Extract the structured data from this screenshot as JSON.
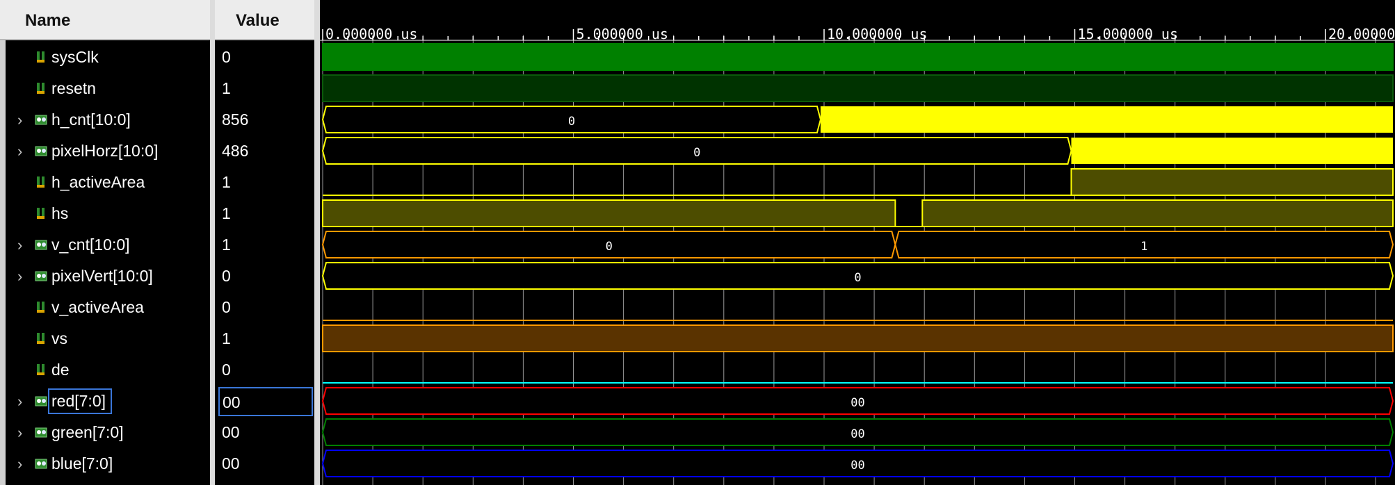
{
  "headers": {
    "name": "Name",
    "value": "Value"
  },
  "timeline": {
    "labels": [
      "0.000000 us",
      "5.000000 us",
      "10.000000 us",
      "15.000000 us",
      "20.00000"
    ],
    "label_times_us": [
      0,
      5,
      10,
      15,
      20
    ]
  },
  "signals": [
    {
      "name": "sysClk",
      "value": "0",
      "expandable": false,
      "icon": "bit-signal-icon"
    },
    {
      "name": "resetn",
      "value": "1",
      "expandable": false,
      "icon": "bit-signal-icon"
    },
    {
      "name": "h_cnt[10:0]",
      "value": "856",
      "expandable": true,
      "icon": "bus-signal-icon"
    },
    {
      "name": "pixelHorz[10:0]",
      "value": "486",
      "expandable": true,
      "icon": "bus-signal-icon"
    },
    {
      "name": "h_activeArea",
      "value": "1",
      "expandable": false,
      "icon": "bit-signal-icon"
    },
    {
      "name": "hs",
      "value": "1",
      "expandable": false,
      "icon": "bit-signal-icon"
    },
    {
      "name": "v_cnt[10:0]",
      "value": "1",
      "expandable": true,
      "icon": "bus-signal-icon"
    },
    {
      "name": "pixelVert[10:0]",
      "value": "0",
      "expandable": true,
      "icon": "bus-signal-icon"
    },
    {
      "name": "v_activeArea",
      "value": "0",
      "expandable": false,
      "icon": "bit-signal-icon"
    },
    {
      "name": "vs",
      "value": "1",
      "expandable": false,
      "icon": "bit-signal-icon"
    },
    {
      "name": "de",
      "value": "0",
      "expandable": false,
      "icon": "bit-signal-icon"
    },
    {
      "name": "red[7:0]",
      "value": "00",
      "expandable": true,
      "icon": "bus-signal-icon",
      "selected": true
    },
    {
      "name": "green[7:0]",
      "value": "00",
      "expandable": true,
      "icon": "bus-signal-icon"
    },
    {
      "name": "blue[7:0]",
      "value": "00",
      "expandable": true,
      "icon": "bus-signal-icon"
    }
  ],
  "waves": [
    {
      "signal": "sysClk",
      "kind": "fill",
      "color": "#008000"
    },
    {
      "signal": "resetn",
      "kind": "fill",
      "color": "#003300",
      "edge": "#0b5a0b"
    },
    {
      "signal": "h_cnt[10:0]",
      "kind": "bus",
      "color": "#ffff00",
      "segments": [
        {
          "t0": 0,
          "t1": 9.93,
          "label": "0"
        },
        {
          "t0": 9.93,
          "t1": 21.5,
          "solid": true
        }
      ]
    },
    {
      "signal": "pixelHorz[10:0]",
      "kind": "bus",
      "color": "#ffff00",
      "segments": [
        {
          "t0": 0,
          "t1": 14.93,
          "label": "0"
        },
        {
          "t0": 14.93,
          "t1": 21.5,
          "solid": true
        }
      ]
    },
    {
      "signal": "h_activeArea",
      "kind": "bit",
      "color": "#ffff00",
      "fill": "#4d4d00",
      "highs": [
        [
          14.93,
          21.5
        ]
      ]
    },
    {
      "signal": "hs",
      "kind": "bit",
      "color": "#ffff00",
      "fill": "#4d4d00",
      "highs": [
        [
          0,
          11.42
        ],
        [
          11.96,
          21.5
        ]
      ]
    },
    {
      "signal": "v_cnt[10:0]",
      "kind": "bus",
      "color": "#ff9900",
      "segments": [
        {
          "t0": 0,
          "t1": 11.42,
          "label": "0"
        },
        {
          "t0": 11.42,
          "t1": 21.5,
          "label": "1"
        }
      ]
    },
    {
      "signal": "pixelVert[10:0]",
      "kind": "bus",
      "color": "#ffff00",
      "segments": [
        {
          "t0": 0,
          "t1": 21.5,
          "label": "0"
        }
      ]
    },
    {
      "signal": "v_activeArea",
      "kind": "bit",
      "color": "#ff9900",
      "fill": "#5a3300",
      "highs": []
    },
    {
      "signal": "vs",
      "kind": "bit",
      "color": "#ff9900",
      "fill": "#5a3300",
      "highs": [
        [
          0,
          21.5
        ]
      ]
    },
    {
      "signal": "de",
      "kind": "bit",
      "color": "#00ffff",
      "fill": "#003333",
      "highs": []
    },
    {
      "signal": "red[7:0]",
      "kind": "bus",
      "color": "#ff0000",
      "segments": [
        {
          "t0": 0,
          "t1": 21.5,
          "label": "00"
        }
      ]
    },
    {
      "signal": "green[7:0]",
      "kind": "bus",
      "color": "#008000",
      "segments": [
        {
          "t0": 0,
          "t1": 21.5,
          "label": "00"
        }
      ]
    },
    {
      "signal": "blue[7:0]",
      "kind": "bus",
      "color": "#0000ff",
      "segments": [
        {
          "t0": 0,
          "t1": 21.5,
          "label": "00"
        }
      ]
    }
  ],
  "colors": {
    "grid": "#9a9a9a",
    "background": "#000000"
  }
}
